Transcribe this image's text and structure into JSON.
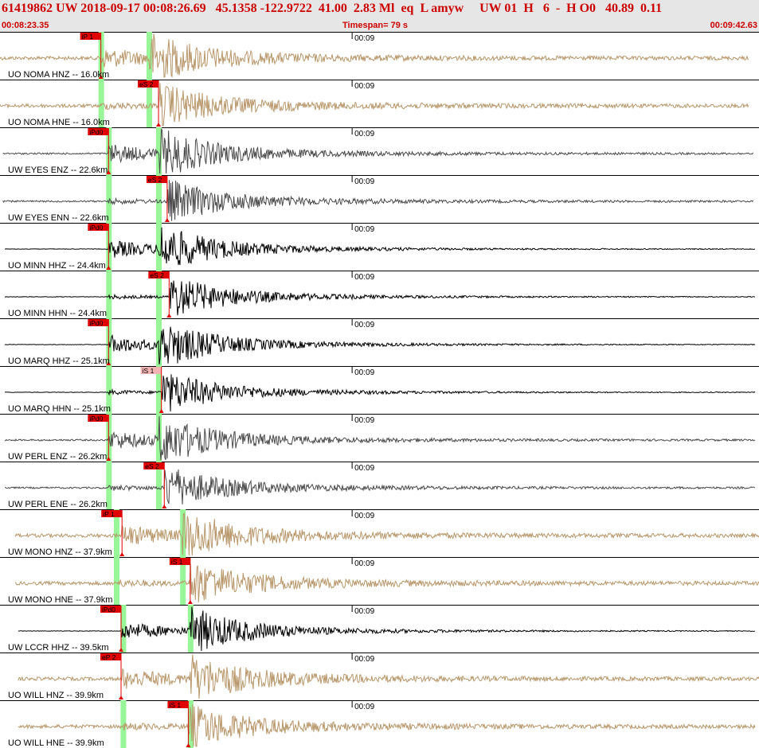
{
  "header": {
    "event_line": "61419862 UW 2018-09-17 00:08:26.69   45.1358 -122.9722  41.00  2.83 Ml  eq  L amyw     UW 01  H   6  -  H O0   40.89  0.11",
    "start_time": "00:08:23.35",
    "timespan": "Timespan=  79 s",
    "end_time": "00:09:42.63"
  },
  "colors": {
    "pick_flag": "#e00000",
    "pick_flag_light": "#f4b4b4",
    "predicted_marker": "#98f598",
    "trace_dark": "#000000",
    "trace_gray": "#4a4a4a",
    "trace_tan": "#b8976b",
    "header_text": "#cc0000",
    "header_bg": "#e6e6e6"
  },
  "chart_data": {
    "type": "waveform",
    "title": "",
    "time_window": {
      "start": "00:08:23.35",
      "end": "00:09:42.63",
      "span_s": 79
    },
    "minute_tick_label": "00:09",
    "minute_tick_seconds": 36.65,
    "predicted_p_seconds": [
      10.5,
      10.5,
      11.3,
      11.3,
      11.3,
      11.3,
      11.3,
      11.3,
      11.3,
      11.3,
      12.1,
      12.1,
      12.8,
      12.8
    ],
    "predicted_s_seconds": [
      15.5,
      15.5,
      16.5,
      16.5,
      16.5,
      16.5,
      16.5,
      16.5,
      16.5,
      16.5,
      19.0,
      19.0,
      19.8,
      19.8
    ],
    "traces": [
      {
        "label": "UO NOMA HNZ -- 16.0km",
        "color": "tan",
        "pick_label": "iP 1",
        "pick_seconds": 10.5,
        "pick_style": "red",
        "start_seconds": 0.0,
        "end_seconds": 78.0
      },
      {
        "label": "UO NOMA HNE -- 16.0km",
        "color": "tan",
        "pick_label": "eS 2",
        "pick_seconds": 16.5,
        "pick_style": "red",
        "start_seconds": 0.0,
        "end_seconds": 78.0
      },
      {
        "label": "UW EYES ENZ -- 22.6km",
        "color": "gray",
        "pick_label": "iPd0",
        "pick_seconds": 11.3,
        "pick_style": "red",
        "start_seconds": 0.3,
        "end_seconds": 78.4
      },
      {
        "label": "UW EYES ENN -- 22.6km",
        "color": "gray",
        "pick_label": "eS 2",
        "pick_seconds": 17.4,
        "pick_style": "red",
        "start_seconds": 0.3,
        "end_seconds": 78.4
      },
      {
        "label": "UO MINN HHZ -- 24.4km",
        "color": "dark",
        "pick_label": "iPd0",
        "pick_seconds": 11.3,
        "pick_style": "red",
        "start_seconds": 0.5,
        "end_seconds": 78.6
      },
      {
        "label": "UO MINN HHN -- 24.4km",
        "color": "dark",
        "pick_label": "eS 2",
        "pick_seconds": 17.6,
        "pick_style": "red",
        "start_seconds": 0.5,
        "end_seconds": 78.6
      },
      {
        "label": "UO MARQ HHZ -- 25.1km",
        "color": "dark",
        "pick_label": "iPd0",
        "pick_seconds": 11.3,
        "pick_style": "red",
        "start_seconds": 0.5,
        "end_seconds": 78.6
      },
      {
        "label": "UO MARQ HHN -- 25.1km",
        "color": "dark",
        "pick_label": "iS 1",
        "pick_seconds": 16.8,
        "pick_style": "light",
        "start_seconds": 0.5,
        "end_seconds": 78.6
      },
      {
        "label": "UW PERL ENZ -- 26.2km",
        "color": "gray",
        "pick_label": "iPd0",
        "pick_seconds": 11.3,
        "pick_style": "red",
        "start_seconds": 0.5,
        "end_seconds": 78.6
      },
      {
        "label": "UW PERL ENE -- 26.2km",
        "color": "gray",
        "pick_label": "eS 2",
        "pick_seconds": 17.1,
        "pick_style": "red",
        "start_seconds": 0.5,
        "end_seconds": 78.6
      },
      {
        "label": "UW MONO HNZ -- 37.9km",
        "color": "tan",
        "pick_label": "iP 1",
        "pick_seconds": 12.7,
        "pick_style": "red",
        "start_seconds": 1.6,
        "end_seconds": 79.28
      },
      {
        "label": "UW MONO HNE -- 37.9km",
        "color": "tan",
        "pick_label": "iS 1",
        "pick_seconds": 19.8,
        "pick_style": "red",
        "start_seconds": 1.6,
        "end_seconds": 79.28
      },
      {
        "label": "UW LCCR HHZ -- 39.5km",
        "color": "dark",
        "pick_label": "iPd0",
        "pick_seconds": 12.6,
        "pick_style": "red",
        "start_seconds": 1.9,
        "end_seconds": 78.6
      },
      {
        "label": "UO WILL HNZ -- 39.9km",
        "color": "tan",
        "pick_label": "eP 2",
        "pick_seconds": 12.6,
        "pick_style": "red",
        "start_seconds": 1.9,
        "end_seconds": 79.28
      },
      {
        "label": "UO WILL HNE -- 39.9km",
        "color": "tan",
        "pick_label": "iS 1",
        "pick_seconds": 19.6,
        "pick_style": "red",
        "start_seconds": 1.9,
        "end_seconds": 78.6
      }
    ]
  }
}
